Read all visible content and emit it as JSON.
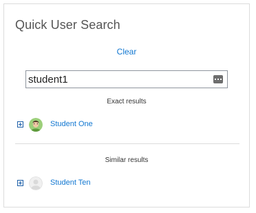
{
  "block": {
    "title": "Quick User Search",
    "clear_label": "Clear"
  },
  "search": {
    "value": "student1",
    "keyboard_icon": "keyboard-icon"
  },
  "exact": {
    "label": "Exact results",
    "users": [
      {
        "name": "Student One",
        "avatar": "photo"
      }
    ]
  },
  "similar": {
    "label": "Similar results",
    "users": [
      {
        "name": "Student Ten",
        "avatar": "default"
      }
    ]
  },
  "colors": {
    "link": "#1177d1",
    "expand_icon": "#1b5ea8",
    "border": "#dcdcdc"
  }
}
